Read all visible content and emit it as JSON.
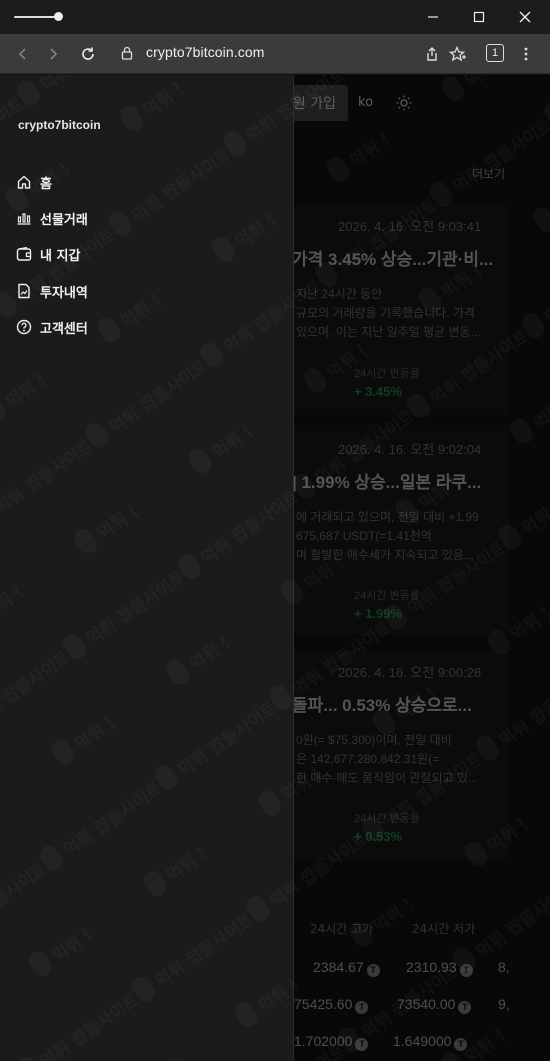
{
  "browser": {
    "url": "crypto7bitcoin.com",
    "tab_count": "1"
  },
  "header": {
    "join_label": "원 가입",
    "lang_label": "ko"
  },
  "news": {
    "more_label": "더보기",
    "items": [
      {
        "date": "2026. 4. 16. 오전 9:03:41",
        "headline": "가격 3.45% 상승...기관·비...",
        "body": [
          "지난 24시간 동안",
          "규모의 거래량을 기록했습니다. 가격",
          "있으며, 이는 지난 일주일 평균 변동..."
        ],
        "change_label": "24시간 변동률",
        "change_value": "+ 3.45%"
      },
      {
        "date": "2026. 4. 16. 오전 9:02:04",
        "headline": "| 1.99% 상승...일본 라쿠...",
        "body": [
          "에 거래되고 있으며, 전일 대비 +1.99",
          "675,687 USDT(=1.41천억",
          "며 활발한 매수세가 지속되고 있음..."
        ],
        "change_label": "24시간 변동률",
        "change_value": "+ 1.99%"
      },
      {
        "date": "2026. 4. 16. 오전 9:00:28",
        "headline": "돌파... 0.53% 상승으로...",
        "body": [
          "0원(= $75,300)이며, 전일 대비",
          "은 142,677,280,842.31원(=",
          "한 매수·매도 움직임이 관찰되고 있..."
        ],
        "change_label": "24시간 변동률",
        "change_value": "+ 0.53%"
      }
    ]
  },
  "table": {
    "headers": [
      "24시간 고가",
      "24시간 저가"
    ],
    "rows": [
      {
        "high": "2384.67",
        "low": "2310.93",
        "extra": "8,"
      },
      {
        "high": "75425.60",
        "low": "73540.00",
        "extra": "9,"
      },
      {
        "high": "1.702000",
        "low": "1.649000",
        "extra": ""
      }
    ],
    "token_symbol": "T"
  },
  "drawer": {
    "brand": "crypto7bitcoin",
    "items": [
      {
        "label": "홈",
        "icon": "home-icon"
      },
      {
        "label": "선물거래",
        "icon": "chart-icon"
      },
      {
        "label": "내 지갑",
        "icon": "wallet-icon"
      },
      {
        "label": "투자내역",
        "icon": "document-chart-icon"
      },
      {
        "label": "고객센터",
        "icon": "help-icon"
      }
    ]
  },
  "watermark": "먹튀 짭돌사이트"
}
